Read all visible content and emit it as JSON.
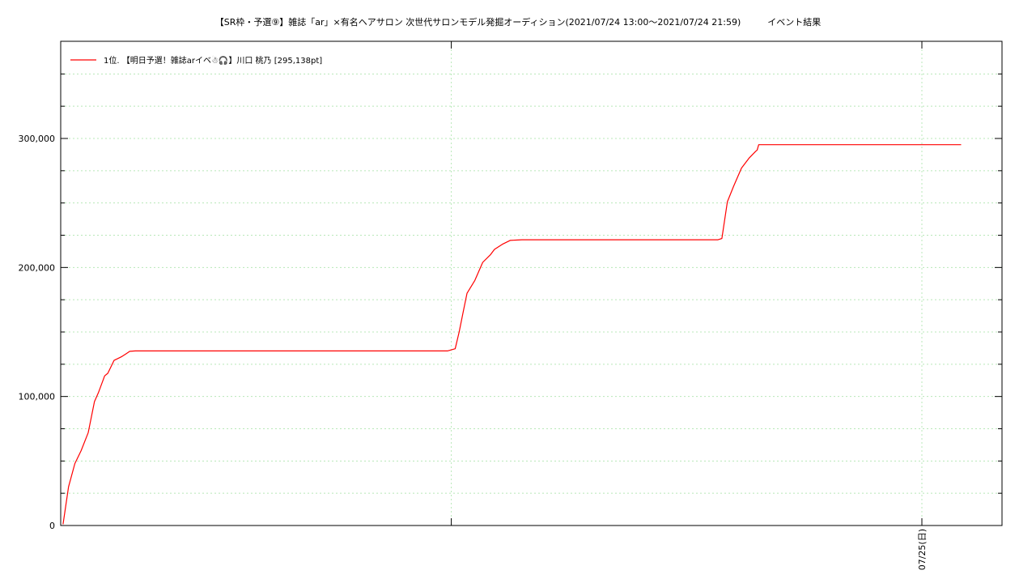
{
  "chart_data": {
    "type": "line",
    "title": "【SR枠・予選⑨】雑誌「ar」×有名ヘアサロン 次世代サロンモデル発掘オーディション(2021/07/24 13:00～2021/07/24 21:59)　　　イベント結果",
    "xlabel": "",
    "ylabel": "",
    "x_unit": "hours since 2021/07/24 00:00",
    "xlim": [
      13.0,
      24.95
    ],
    "ylim": [
      0,
      300000
    ],
    "y_ticks": [
      0,
      100000,
      200000,
      300000
    ],
    "y_tick_labels": [
      "0",
      "100,000",
      "200,000",
      "300,000"
    ],
    "x_tick_labels": [
      {
        "x": 18.0,
        "label": ""
      },
      {
        "x": 24.0,
        "label": "07/25(日)"
      }
    ],
    "grid": true,
    "legend_position": "top-left",
    "series": [
      {
        "name": "1位. 【明日予選！雑誌arイベ☃🎧】川口 桃乃 [295,138pt]",
        "color": "#ff0000",
        "x": [
          13.05,
          13.12,
          13.2,
          13.28,
          13.37,
          13.45,
          13.5,
          13.58,
          13.62,
          13.7,
          13.75,
          13.8,
          13.85,
          13.9,
          13.97,
          14.02,
          14.1,
          14.5,
          15.5,
          16.5,
          17.5,
          17.95,
          18.05,
          18.1,
          18.15,
          18.2,
          18.3,
          18.4,
          18.5,
          18.55,
          18.65,
          18.75,
          18.9,
          19.5,
          20.5,
          21.0,
          21.4,
          21.45,
          21.52,
          21.6,
          21.7,
          21.8,
          21.88,
          21.9,
          21.92,
          22.5,
          23.5,
          24.5
        ],
        "values": [
          1000,
          30000,
          48000,
          58000,
          72000,
          96000,
          103000,
          116000,
          118000,
          128000,
          129500,
          131000,
          133000,
          135000,
          135300,
          135300,
          135300,
          135300,
          135300,
          135300,
          135300,
          135300,
          137000,
          150000,
          165000,
          180000,
          190000,
          204000,
          210000,
          214000,
          218000,
          221000,
          221500,
          221500,
          221500,
          221500,
          221500,
          222500,
          251000,
          263000,
          277000,
          285000,
          290000,
          291000,
          295138,
          295138,
          295138,
          295138
        ]
      }
    ]
  }
}
